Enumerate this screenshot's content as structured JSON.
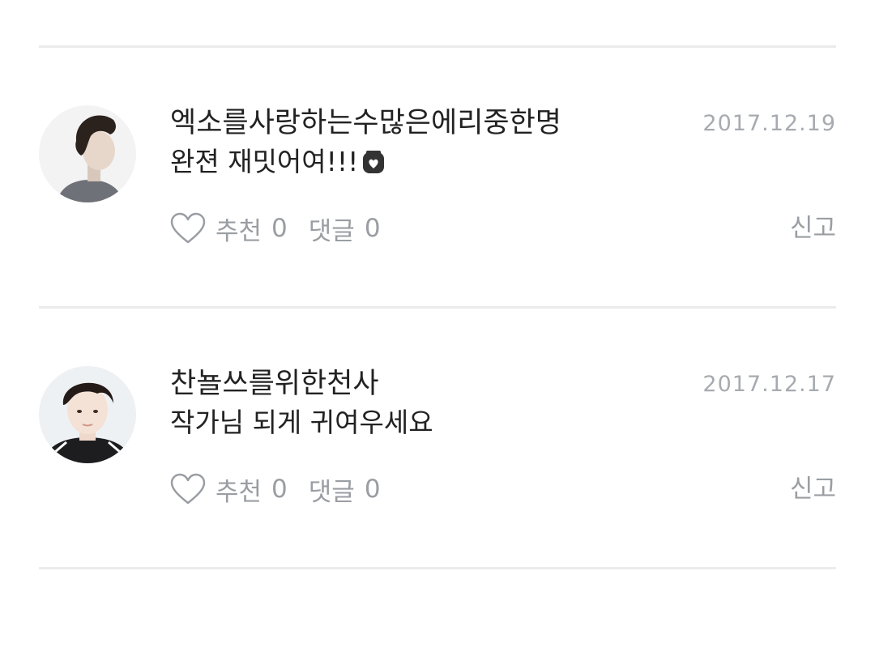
{
  "comments": [
    {
      "author": "엑소를사랑하는수많은에리중한명",
      "date": "2017.12.19",
      "text": "완젼 재밋어여!!!",
      "emoji": "heart-cup-emoji-icon",
      "like_label": "추천",
      "like_count": "0",
      "reply_label": "댓글",
      "reply_count": "0",
      "report_label": "신고"
    },
    {
      "author": "찬뇰쓰를위한천사",
      "date": "2017.12.17",
      "text": "작가님 되게 귀여우세요",
      "like_label": "추천",
      "like_count": "0",
      "reply_label": "댓글",
      "reply_count": "0",
      "report_label": "신고"
    }
  ],
  "colors": {
    "divider": "#ebebeb",
    "text": "#222222",
    "muted": "#9a9ea3",
    "date": "#a7abb0"
  }
}
